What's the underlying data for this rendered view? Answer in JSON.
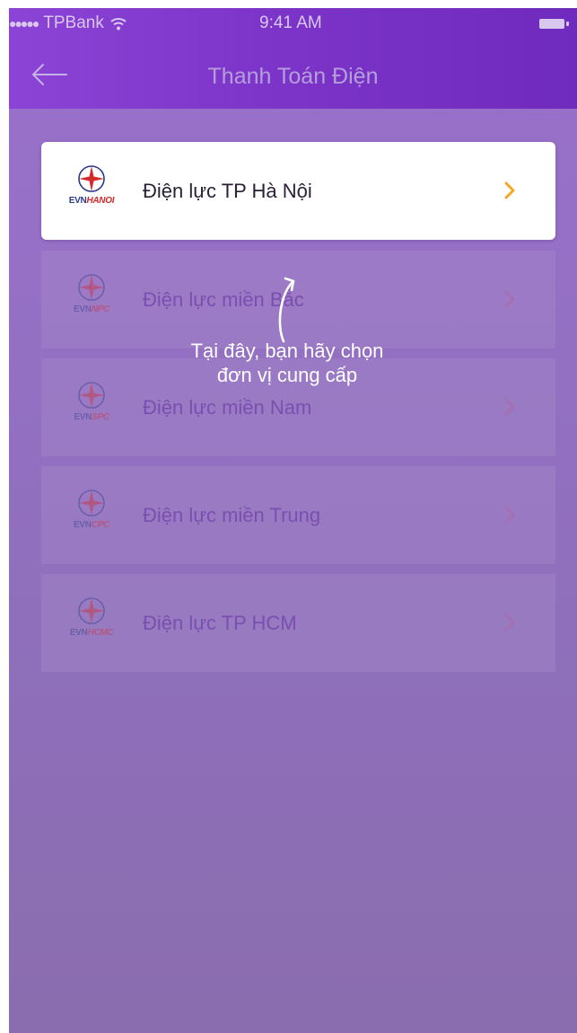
{
  "status_bar": {
    "signal": "●●●●●",
    "carrier": "TPBank",
    "time": "9:41 AM"
  },
  "nav": {
    "title": "Thanh Toán Điện"
  },
  "providers": [
    {
      "logo_prefix": "EVN",
      "logo_unit": "HANOI",
      "label": "Điện lực TP Hà Nội"
    },
    {
      "logo_prefix": "EVN",
      "logo_unit": "NPC",
      "label": "Điện lực miền Bắc"
    },
    {
      "logo_prefix": "EVN",
      "logo_unit": "SPC",
      "label": "Điện lực miền Nam"
    },
    {
      "logo_prefix": "EVN",
      "logo_unit": "CPC",
      "label": "Điện lực  miền Trung"
    },
    {
      "logo_prefix": "EVN",
      "logo_unit": "HCMC",
      "label": "Điện lực TP HCM"
    }
  ],
  "tooltip": {
    "line1": "Tại đây, bạn hãy chọn",
    "line2": "đơn vị cung cấp"
  },
  "colors": {
    "header": "#7d34c9",
    "background": "#9870c9",
    "chevron": "#f5a623",
    "logo_red": "#d42a2a",
    "logo_blue": "#2a3a8c"
  },
  "icons": {
    "back": "arrow-left-icon",
    "chevron": "chevron-right-icon",
    "logo": "evn-compass-star-icon",
    "wifi": "wifi-icon",
    "battery": "battery-icon"
  }
}
